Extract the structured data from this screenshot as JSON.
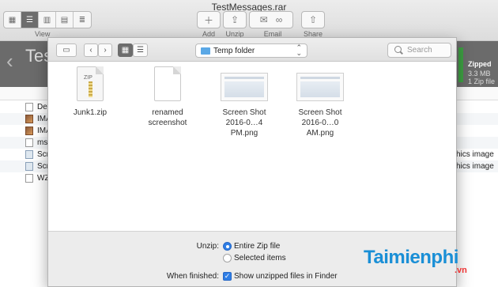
{
  "window": {
    "title": "TestMessages.rar",
    "view_label": "View",
    "toolbar": [
      {
        "label": "Add",
        "icon": "plus-icon"
      },
      {
        "label": "Unzip",
        "icon": "unzip-icon"
      },
      {
        "label": "Email",
        "icon": "envelope-icon"
      },
      {
        "label": "Share",
        "icon": "share-icon"
      }
    ],
    "archive_name_partial": "Tes",
    "zip_status": {
      "title": "Zipped",
      "size": "3.3 MB",
      "count": "1 Zip file"
    },
    "list": {
      "rows": [
        {
          "name": "Def",
          "kind": "",
          "icon": "document-icon"
        },
        {
          "name": "IMA",
          "kind": "",
          "icon": "image-icon"
        },
        {
          "name": "IMA",
          "kind": "",
          "icon": "image-icon"
        },
        {
          "name": "ms",
          "kind": "",
          "icon": "document-icon"
        },
        {
          "name": "Scr",
          "kind": "hics image",
          "icon": "screenshot-icon"
        },
        {
          "name": "Scr",
          "kind": "hics image",
          "icon": "screenshot-icon"
        },
        {
          "name": "WZ",
          "kind": "",
          "icon": "document-icon"
        }
      ]
    }
  },
  "sheet": {
    "folder": "Temp folder",
    "search_placeholder": "Search",
    "files": [
      {
        "name": "Junk1.zip",
        "type": "zip",
        "badge": "ZIP"
      },
      {
        "name": "renamed screenshot",
        "type": "document"
      },
      {
        "name": "Screen Shot 2016-0…4 PM.png",
        "type": "screenshot"
      },
      {
        "name": "Screen Shot 2016-0…0 AM.png",
        "type": "screenshot"
      }
    ],
    "unzip_label": "Unzip:",
    "option_entire": "Entire Zip file",
    "option_selected": "Selected items",
    "finished_label": "When finished:",
    "finished_option": "Show unzipped files in Finder"
  },
  "watermark": {
    "text": "Taimienphi",
    "suffix": ".vn"
  },
  "colors": {
    "accent": "#2e7ee6",
    "zipped_green": "#3ea043",
    "header_dark": "#6b6b6b",
    "watermark_blue": "#1a8fd6"
  }
}
